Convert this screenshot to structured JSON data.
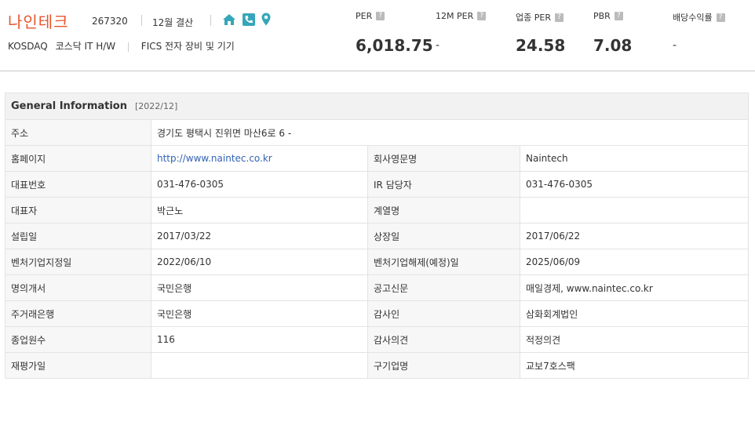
{
  "company": {
    "name": "나인테크",
    "code": "267320",
    "fiscal": "12월 결산",
    "market": "KOSDAQ",
    "sector": "코스닥 IT H/W",
    "fics": "FICS 전자 장비 및 기기"
  },
  "icons": [
    "home-icon",
    "phone-icon",
    "location-icon"
  ],
  "metrics": [
    {
      "label": "PER",
      "value": "6,018.75"
    },
    {
      "label": "12M PER",
      "value": "-"
    },
    {
      "label": "업종 PER",
      "value": "24.58"
    },
    {
      "label": "PBR",
      "value": "7.08"
    },
    {
      "label": "배당수익률",
      "value": "-"
    }
  ],
  "help_glyph": "?",
  "table": {
    "title": "General Information",
    "date": "[2022/12]",
    "address_label": "주소",
    "address_value": "경기도 평택시 진위면 마산6로 6 -",
    "rows": [
      {
        "l1": "홈페이지",
        "v1": "http://www.naintec.co.kr",
        "l2": "회사영문명",
        "v2": "Naintech"
      },
      {
        "l1": "대표번호",
        "v1": "031-476-0305",
        "l2": "IR 담당자",
        "v2": "031-476-0305"
      },
      {
        "l1": "대표자",
        "v1": "박근노",
        "l2": "계열명",
        "v2": ""
      },
      {
        "l1": "설립일",
        "v1": "2017/03/22",
        "l2": "상장일",
        "v2": "2017/06/22"
      },
      {
        "l1": "벤처기업지정일",
        "v1": "2022/06/10",
        "l2": "벤처기업해제(예정)일",
        "v2": "2025/06/09"
      },
      {
        "l1": "명의개서",
        "v1": "국민은행",
        "l2": "공고신문",
        "v2": "매일경제, www.naintec.co.kr"
      },
      {
        "l1": "주거래은행",
        "v1": "국민은행",
        "l2": "감사인",
        "v2": "삼화회계법인"
      },
      {
        "l1": "종업원수",
        "v1": "116",
        "l2": "감사의견",
        "v2": "적정의견"
      },
      {
        "l1": "재평가일",
        "v1": "",
        "l2": "구기업명",
        "v2": "교보7호스팩"
      }
    ]
  },
  "colors": {
    "accent": "#e8542b",
    "icon": "#35a6b8",
    "link": "#3363b5"
  }
}
